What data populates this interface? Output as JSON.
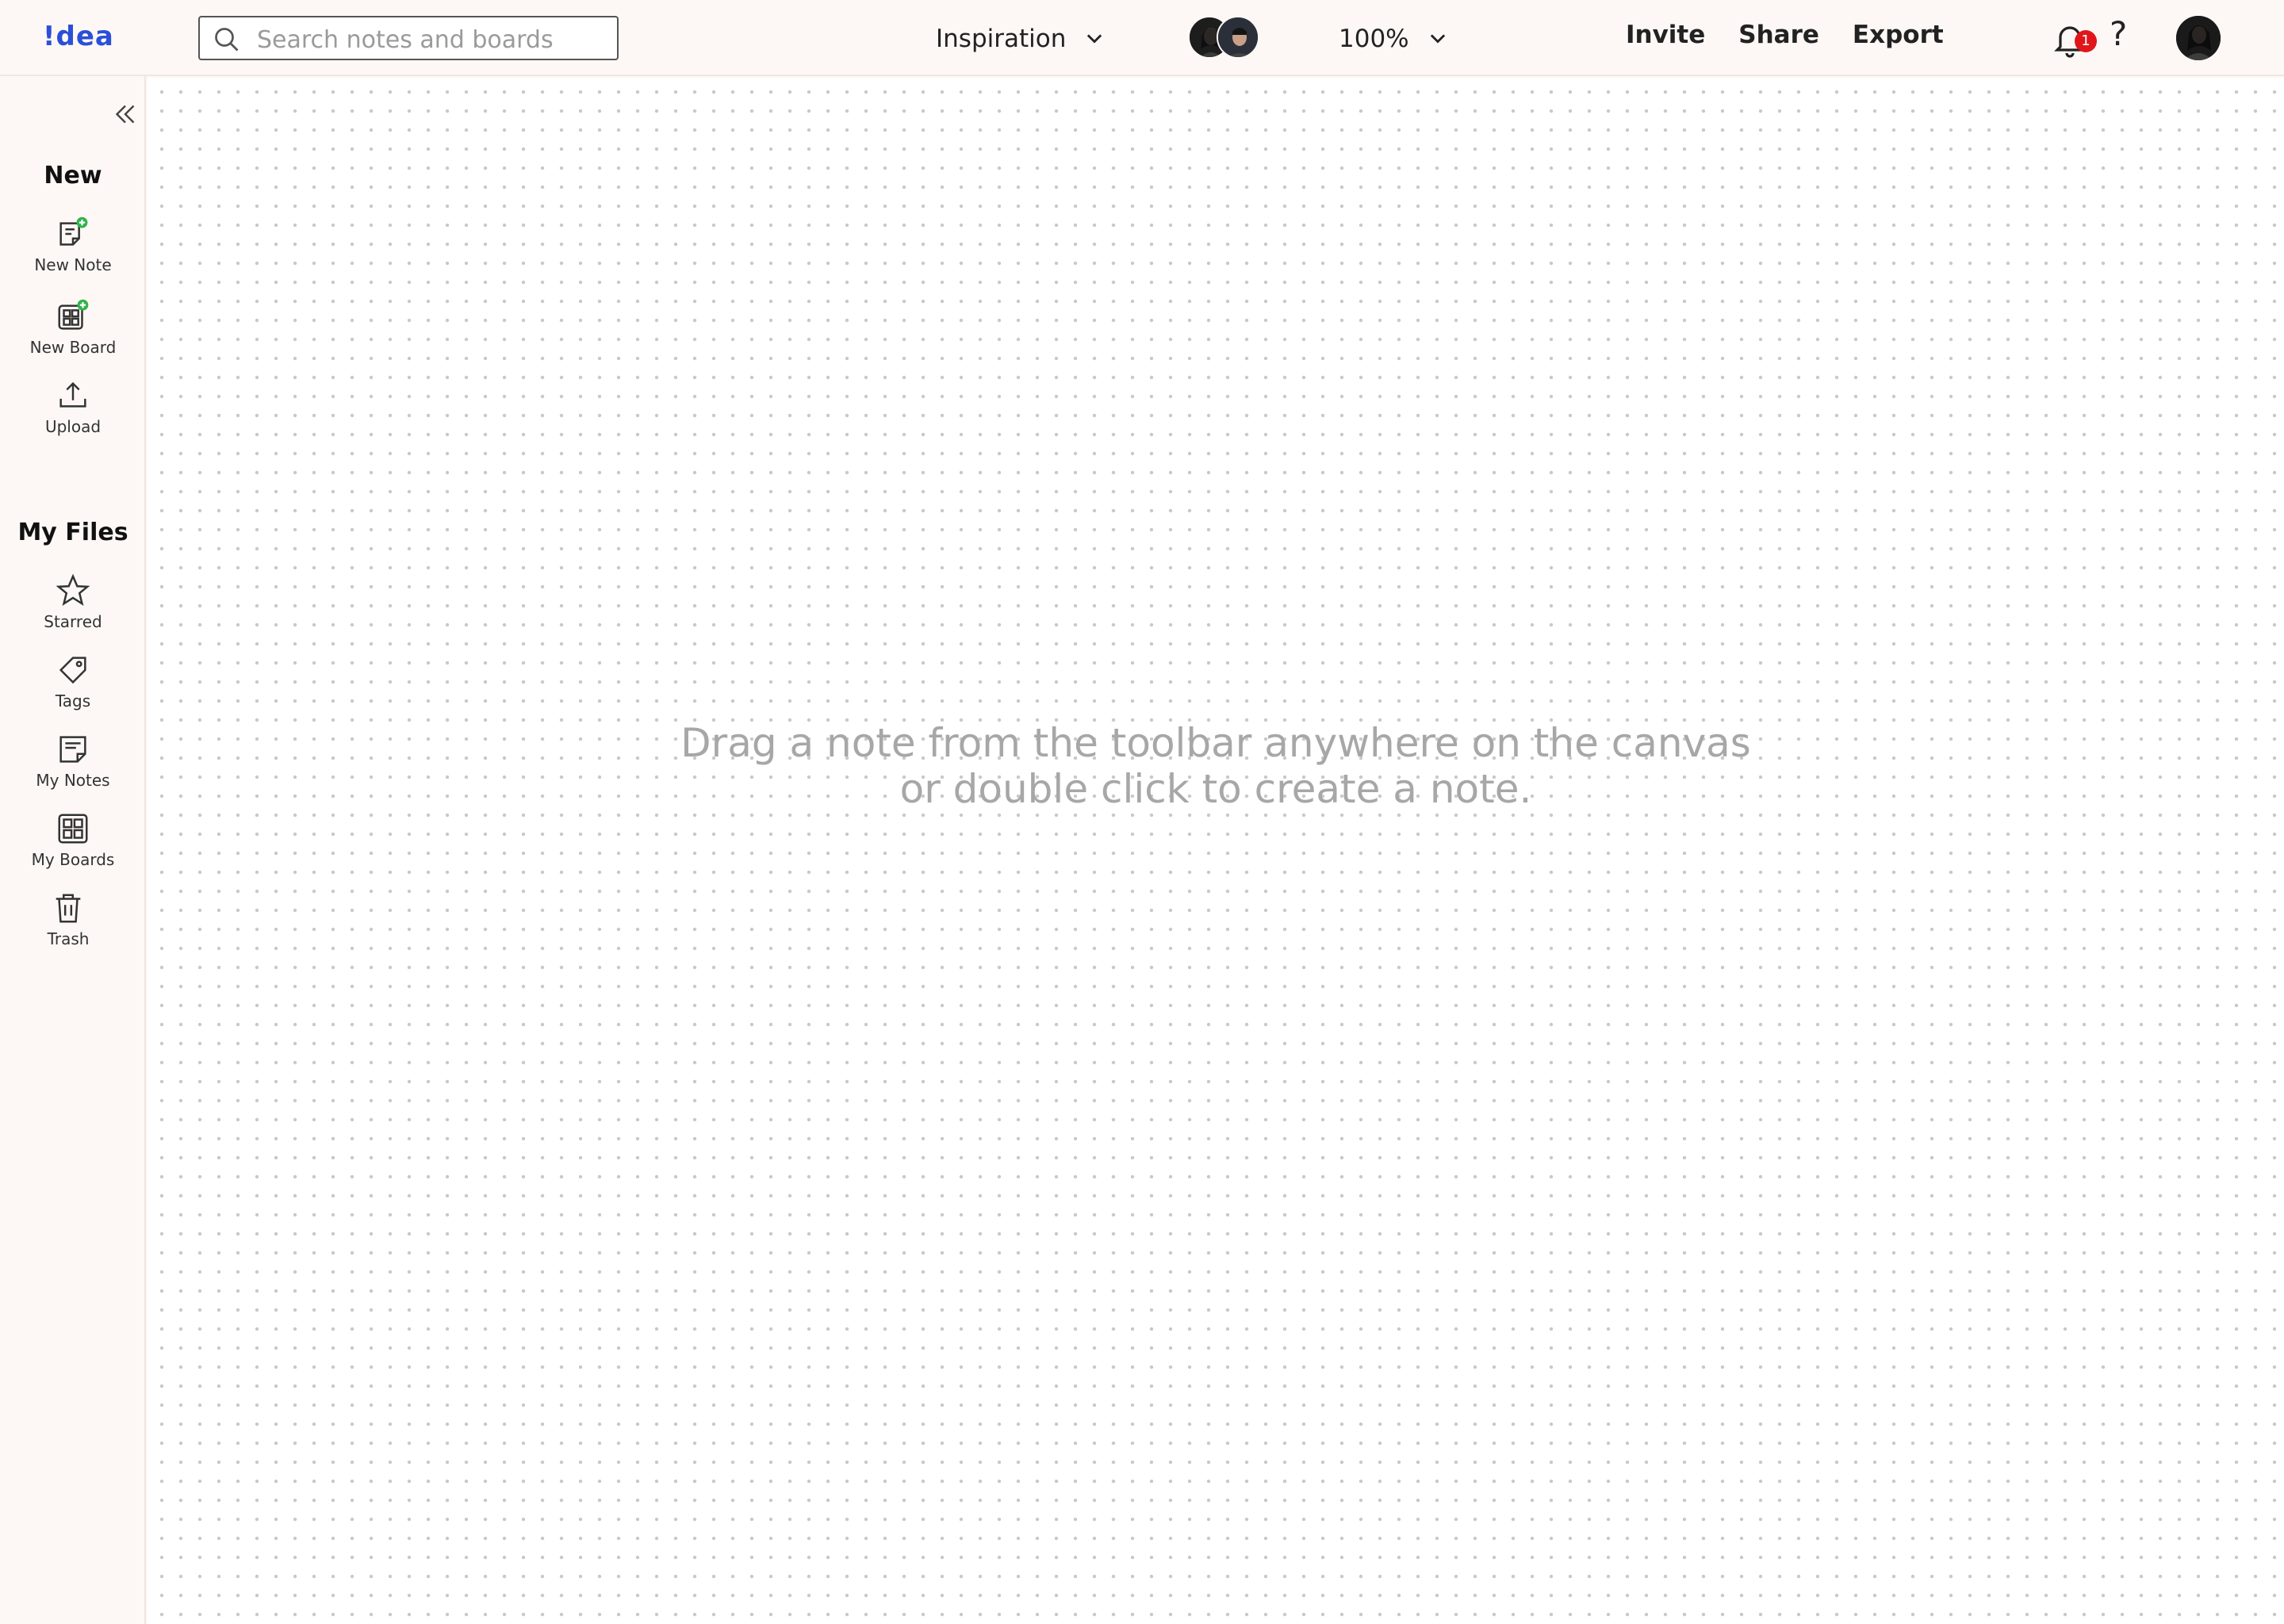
{
  "header": {
    "logo": "!dea",
    "search_placeholder": "Search notes and boards",
    "board_name": "Inspiration",
    "zoom": "100%",
    "actions": {
      "invite": "Invite",
      "share": "Share",
      "export": "Export"
    },
    "notification_count": "1",
    "help": "?"
  },
  "sidebar": {
    "new_title": "New",
    "new_items": [
      {
        "label": "New Note",
        "icon": "new-note-icon"
      },
      {
        "label": "New Board",
        "icon": "new-board-icon"
      },
      {
        "label": "Upload",
        "icon": "upload-icon"
      }
    ],
    "files_title": "My Files",
    "file_items": [
      {
        "label": "Starred",
        "icon": "star-icon"
      },
      {
        "label": "Tags",
        "icon": "tag-icon"
      },
      {
        "label": "My Notes",
        "icon": "note-icon"
      },
      {
        "label": "My Boards",
        "icon": "board-grid-icon"
      },
      {
        "label": "Trash",
        "icon": "trash-icon"
      }
    ]
  },
  "canvas": {
    "hint_line1": "Drag a note from the toolbar anywhere on the canvas",
    "hint_line2": "or double click to create a note."
  },
  "colors": {
    "accent": "#2b4fd8",
    "badge": "#e0161b",
    "plus_badge": "#2fb34a",
    "background": "#fdf8f5"
  }
}
